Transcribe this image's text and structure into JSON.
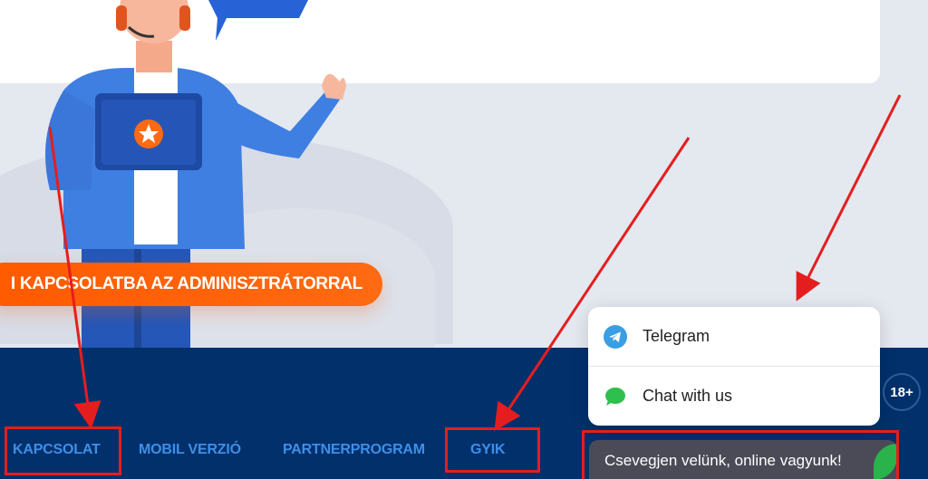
{
  "hero": {
    "contact_button_label": "I KAPCSOLATBA AZ ADMINISZTRÁTORRAL"
  },
  "footer": {
    "nav": [
      {
        "label": "KAPCSOLAT"
      },
      {
        "label": "MOBIL VERZIÓ"
      },
      {
        "label": "PARTNERPROGRAM"
      },
      {
        "label": "GYIK"
      }
    ],
    "age_badge": "18+"
  },
  "contact_popup": {
    "items": [
      {
        "label": "Telegram",
        "icon": "telegram-icon"
      },
      {
        "label": "Chat with us",
        "icon": "chat-bubble-icon"
      }
    ]
  },
  "chat_widget": {
    "label": "Csevegjen velünk, online vagyunk!"
  },
  "colors": {
    "footer_bg": "#02306b",
    "nav_link": "#3d8fe8",
    "accent_orange": "#ff5a00",
    "annotation_red": "#e41e1e",
    "chat_bar": "#4a4b57"
  }
}
